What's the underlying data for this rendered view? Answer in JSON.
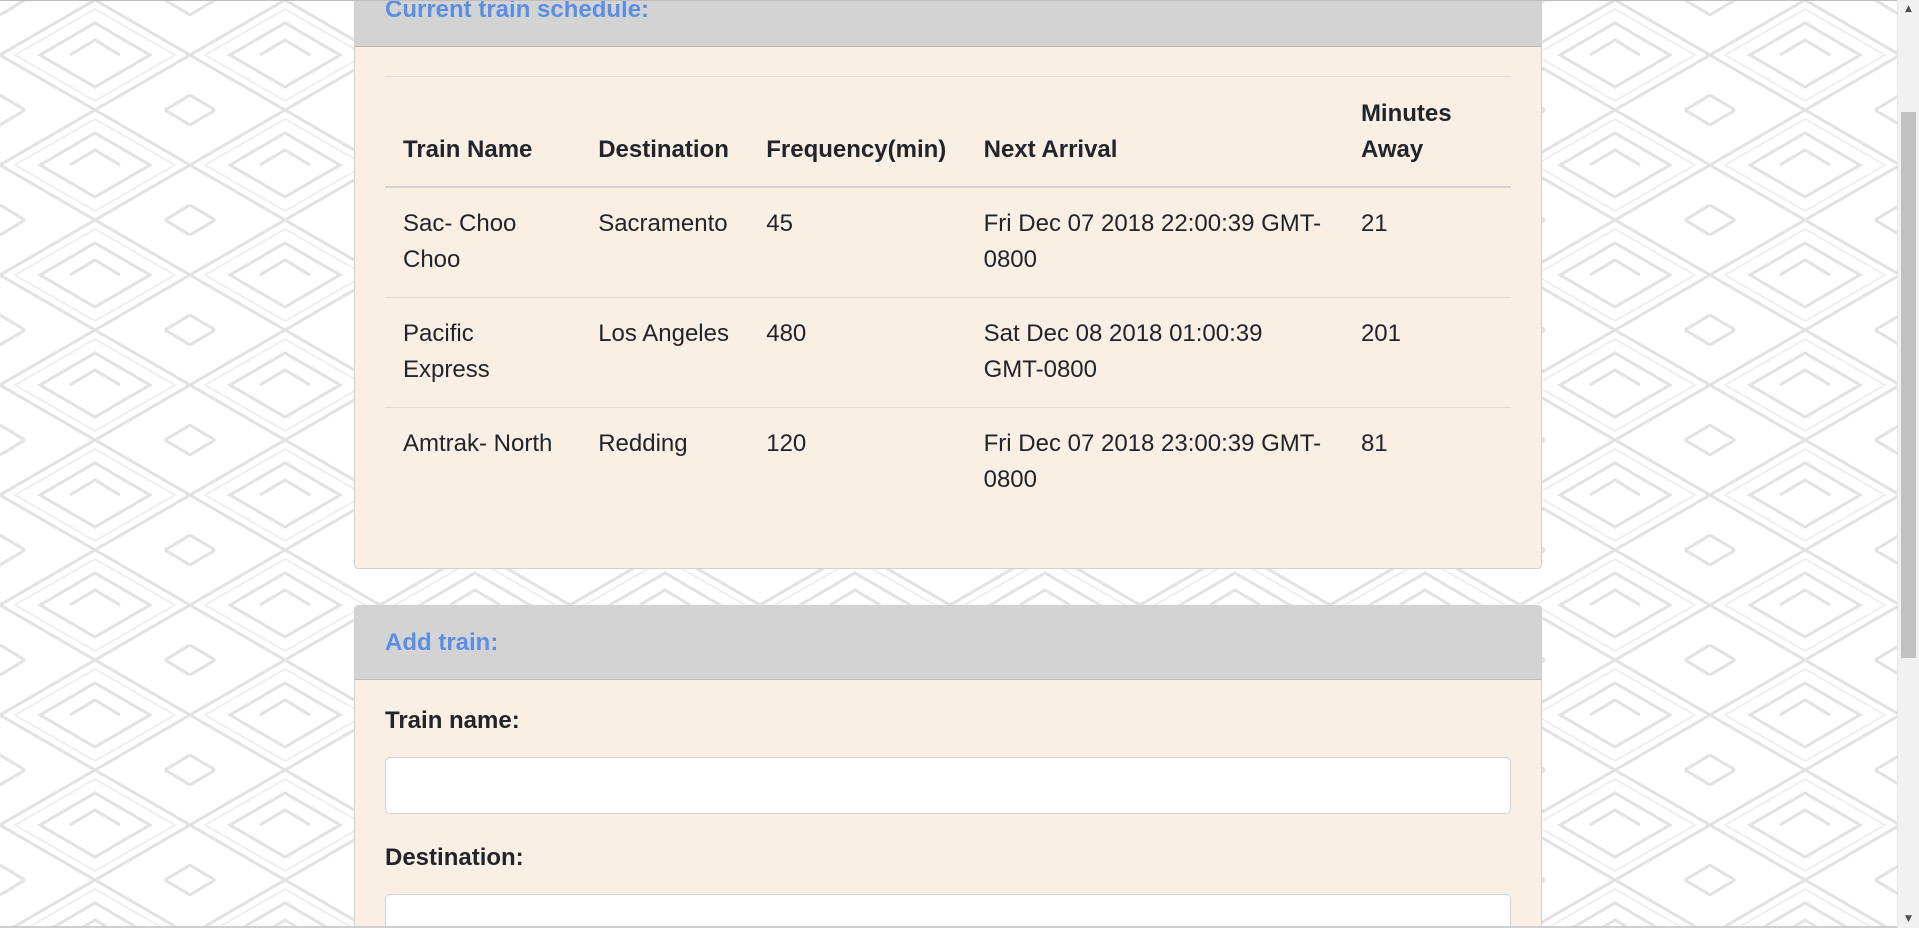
{
  "colors": {
    "header_text": "#5b8fe3",
    "card_bg": "#faefe5",
    "card_header_bg": "#d3d3d3"
  },
  "schedule": {
    "title": "Current train schedule:",
    "columns": [
      "Train Name",
      "Destination",
      "Frequency(min)",
      "Next Arrival",
      "Minutes Away"
    ],
    "rows": [
      [
        "Sac- Choo Choo",
        "Sacramento",
        "45",
        "Fri Dec 07 2018 22:00:39 GMT-0800",
        "21"
      ],
      [
        "Pacific Express",
        "Los Angeles",
        "480",
        "Sat Dec 08 2018 01:00:39 GMT-0800",
        "201"
      ],
      [
        "Amtrak- North",
        "Redding",
        "120",
        "Fri Dec 07 2018 23:00:39 GMT-0800",
        "81"
      ]
    ]
  },
  "add_train": {
    "title": "Add train:",
    "train_name_label": "Train name:",
    "train_name_value": "",
    "destination_label": "Destination:",
    "destination_value": ""
  },
  "scrollbar": {
    "up_icon": "scroll-up-arrow-icon",
    "down_icon": "scroll-down-arrow-icon"
  }
}
